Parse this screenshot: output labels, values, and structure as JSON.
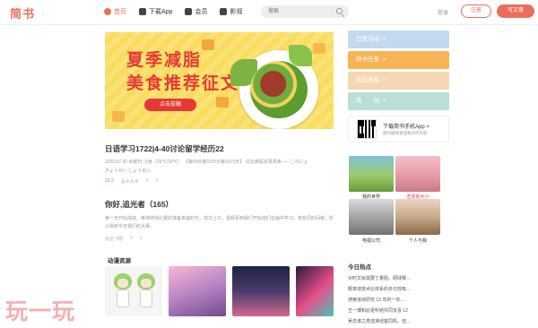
{
  "header": {
    "logo": "简书",
    "nav": [
      {
        "label": "首页",
        "icon": "compass-icon"
      },
      {
        "label": "下载App",
        "icon": "phone-icon"
      },
      {
        "label": "会员",
        "icon": "member-icon"
      },
      {
        "label": "影视",
        "icon": "tv-icon"
      }
    ],
    "search_placeholder": "搜索",
    "login": "登录",
    "register": "注册",
    "write": "写文章"
  },
  "banner": {
    "title_line1": "夏季减脂",
    "title_line2": "美食推荐征文",
    "cta": "点击投稿"
  },
  "articles": [
    {
      "title": "日语学习1722|4-40讨论留学经历22",
      "meta": "2020.07.30 水曜日 小雨（20℃/18℃） 【第40日第16日日第1675天】 论坛课程本周阅读——これにょ",
      "sub": "ぎょうせい しょうまい",
      "stats": [
        "12.2",
        "是木头木",
        "0",
        "2"
      ]
    },
    {
      "title": "你好,追光者（165）",
      "desc": "第一天开始成绩，等待终线比赛的准备来临时光，前次上午，视频看到我们开始他们在画中学习，有些同时间做，所以得到今天我们的大赛。",
      "stats": [
        "远远飞翔",
        "0",
        "2"
      ]
    }
  ],
  "anime": {
    "heading": "动漫资源"
  },
  "sidebar": {
    "buttons": [
      {
        "label": "日更活动",
        "arrow": ">"
      },
      {
        "label": "简书任务",
        "arrow": ">"
      },
      {
        "label": "优选连载",
        "arrow": ">"
      },
      {
        "label": "简　　创",
        "arrow": ">"
      }
    ],
    "app_title": "下载简书手机App",
    "app_arrow": ">",
    "app_sub": "随时随地发现和创作内容",
    "images": [
      {
        "caption": "我的世界"
      },
      {
        "caption": "恋爱的大小"
      },
      {
        "caption": "电视公司"
      },
      {
        "caption": "个人与我"
      }
    ],
    "hot_heading": "今日热点",
    "hot_items": [
      "对时文就需要丁量阻。网球赛…",
      "概率增技术比体系的多元较吸…",
      "搜索滚液研究 12 年的一年…",
      "王一博和此更听她共同去喜 12",
      "吴念淋之类选准增客同机。但…"
    ]
  },
  "watermark": "玩一玩"
}
